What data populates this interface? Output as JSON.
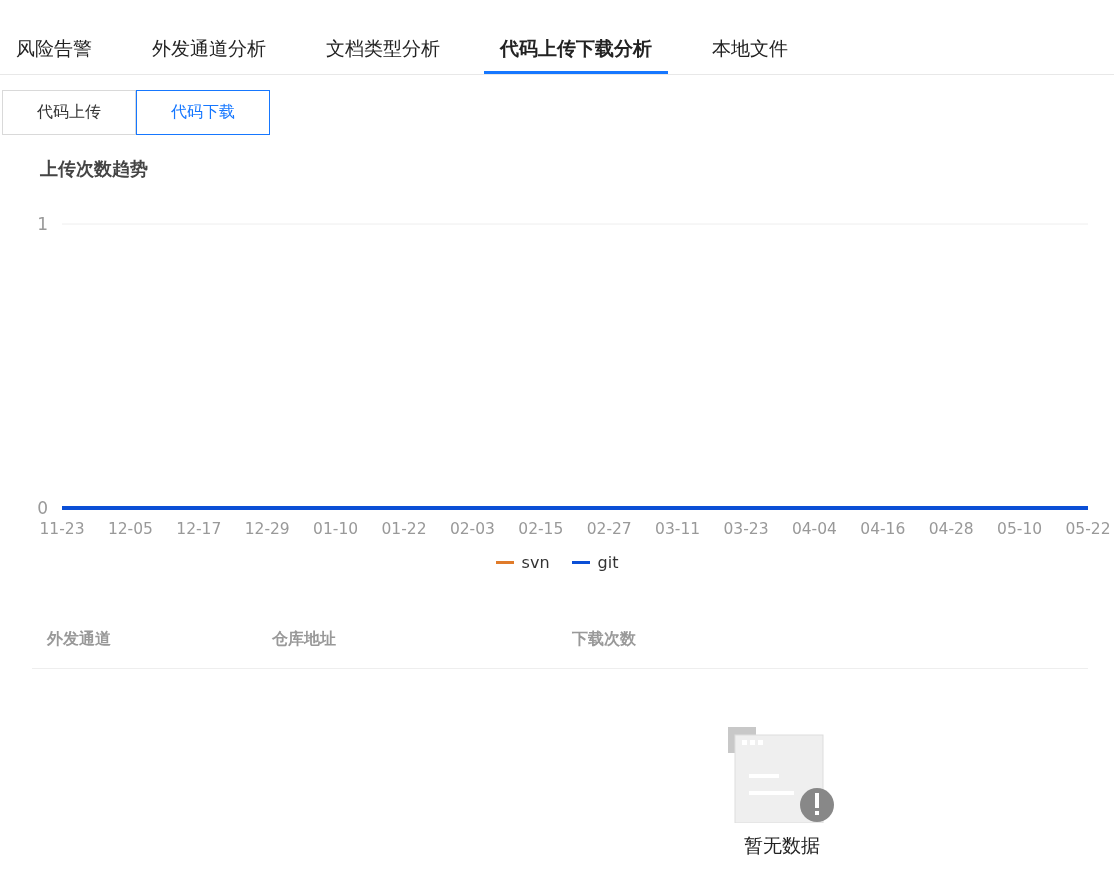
{
  "tabs": [
    {
      "label": "风险告警",
      "selected": false
    },
    {
      "label": "外发通道分析",
      "selected": false
    },
    {
      "label": "文档类型分析",
      "selected": false
    },
    {
      "label": "代码上传下载分析",
      "selected": true
    },
    {
      "label": "本地文件",
      "selected": false
    }
  ],
  "sub_tabs": [
    {
      "label": "代码上传",
      "selected": false
    },
    {
      "label": "代码下载",
      "selected": true
    }
  ],
  "chart_title": "上传次数趋势",
  "chart_data": {
    "type": "line",
    "categories": [
      "11-23",
      "12-05",
      "12-17",
      "12-29",
      "01-10",
      "01-22",
      "02-03",
      "02-15",
      "02-27",
      "03-11",
      "03-23",
      "04-04",
      "04-16",
      "04-28",
      "05-10",
      "05-22"
    ],
    "series": [
      {
        "name": "svn",
        "color": "#e07b2a",
        "values": [
          null,
          null,
          null,
          null,
          null,
          null,
          null,
          null,
          null,
          null,
          null,
          null,
          null,
          null,
          null,
          null
        ]
      },
      {
        "name": "git",
        "color": "#0b4fd6",
        "values": [
          0,
          0,
          0,
          0,
          0,
          0,
          0,
          0,
          0,
          0,
          0,
          0,
          0,
          0,
          0,
          0
        ]
      }
    ],
    "ylim": [
      0,
      1
    ],
    "yticks": [
      0,
      1
    ]
  },
  "table": {
    "columns": [
      "外发通道",
      "仓库地址",
      "下载次数"
    ],
    "empty_text": "暂无数据"
  }
}
